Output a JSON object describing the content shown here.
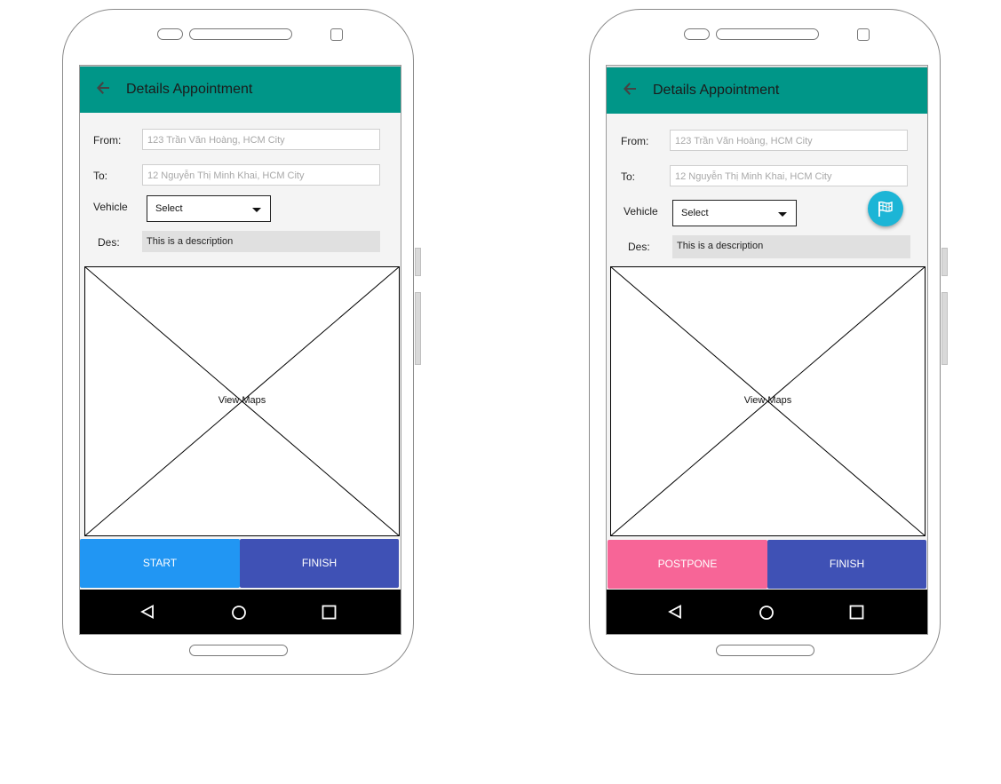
{
  "screens": [
    {
      "app_bar": {
        "title": "Details Appointment",
        "back_icon": "arrow-left-icon"
      },
      "form": {
        "from_label": "From:",
        "from_placeholder": "123 Trần Văn Hoàng, HCM City",
        "to_label": "To:",
        "to_placeholder": "12 Nguyễn Thị Minh Khai, HCM City",
        "vehicle_label": "Vehicle",
        "vehicle_selected": "Select",
        "des_label": "Des:",
        "des_value": "This is a description"
      },
      "map": {
        "label": "View Maps"
      },
      "actions": {
        "primary": "START",
        "secondary": "FINISH"
      },
      "colors": {
        "appbar": "#009688",
        "primary": "#2196f3",
        "secondary": "#3f51b5"
      }
    },
    {
      "app_bar": {
        "title": "Details Appointment",
        "back_icon": "arrow-left-icon"
      },
      "form": {
        "from_label": "From:",
        "from_placeholder": "123 Trần Văn Hoàng, HCM City",
        "to_label": "To:",
        "to_placeholder": "12 Nguyễn Thị Minh Khai, HCM City",
        "vehicle_label": "Vehicle",
        "vehicle_selected": "Select",
        "des_label": "Des:",
        "des_value": "This is a description"
      },
      "fab_icon": "flag-icon",
      "map": {
        "label": "View Maps"
      },
      "actions": {
        "primary": "POSTPONE",
        "secondary": "FINISH"
      },
      "colors": {
        "appbar": "#009688",
        "primary": "#f76597",
        "secondary": "#3f51b5"
      }
    }
  ],
  "navigation": {
    "icons": [
      "back-triangle-icon",
      "home-circle-icon",
      "recents-square-icon"
    ]
  }
}
